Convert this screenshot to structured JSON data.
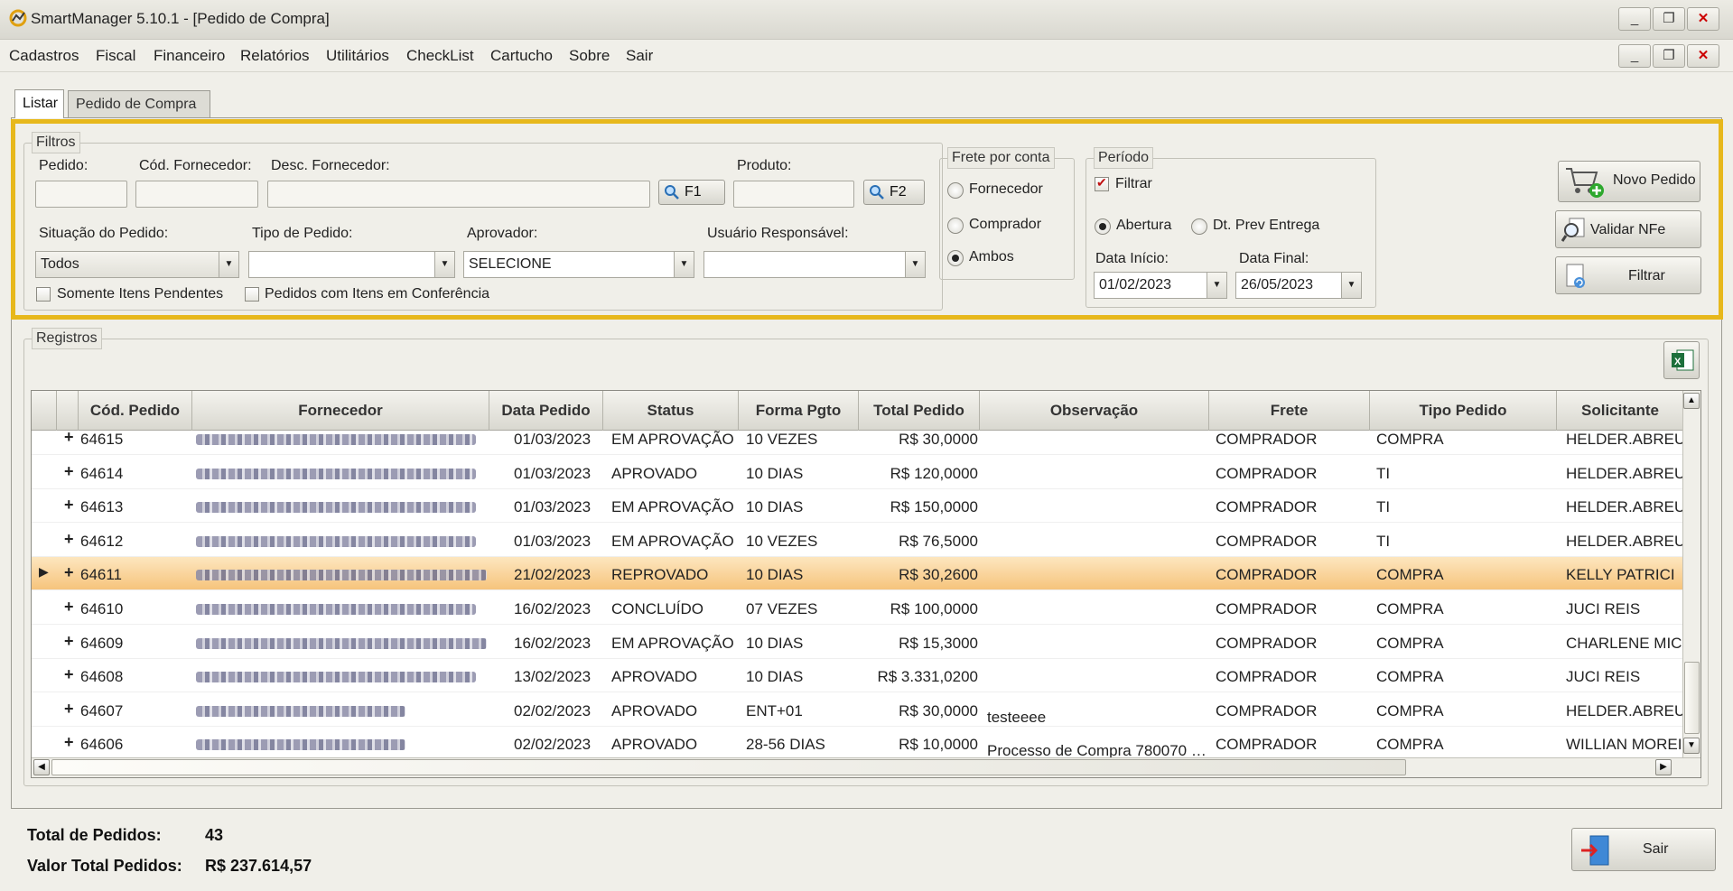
{
  "window": {
    "title": "SmartManager 5.10.1 - [Pedido de Compra]",
    "controls": [
      "_",
      "❐",
      "✕"
    ]
  },
  "menu": [
    "Cadastros",
    "Fiscal",
    "Financeiro",
    "Relatórios",
    "Utilitários",
    "CheckList",
    "Cartucho",
    "Sobre",
    "Sair"
  ],
  "tabs": [
    {
      "label": "Listar",
      "active": true
    },
    {
      "label": "Pedido de Compra",
      "active": false
    }
  ],
  "filtros": {
    "legend": "Filtros",
    "pedido_label": "Pedido:",
    "cod_fornecedor_label": "Cód. Fornecedor:",
    "desc_fornecedor_label": "Desc. Fornecedor:",
    "f1_label": "F1",
    "produto_label": "Produto:",
    "f2_label": "F2",
    "situacao_label": "Situação do Pedido:",
    "situacao_value": "Todos",
    "tipo_label": "Tipo de Pedido:",
    "tipo_value": "",
    "aprovador_label": "Aprovador:",
    "aprovador_value": "SELECIONE",
    "usuario_label": "Usuário Responsável:",
    "usuario_value": "",
    "somente_pendentes_label": "Somente Itens Pendentes",
    "conferencia_label": "Pedidos com Itens em Conferência"
  },
  "frete": {
    "legend": "Frete por conta",
    "options": [
      "Fornecedor",
      "Comprador",
      "Ambos"
    ],
    "selected": "Ambos"
  },
  "periodo": {
    "legend": "Período",
    "filtrar_label": "Filtrar",
    "filtrar_checked": true,
    "abertura_label": "Abertura",
    "dt_prev_label": "Dt. Prev Entrega",
    "selected": "Abertura",
    "data_inicio_label": "Data Início:",
    "data_inicio": "01/02/2023",
    "data_final_label": "Data Final:",
    "data_final": "26/05/2023"
  },
  "buttons": {
    "novo_pedido": "Novo Pedido",
    "validar_nfe": "Validar NFe",
    "filtrar": "Filtrar",
    "sair": "Sair"
  },
  "registros": {
    "legend": "Registros",
    "columns": [
      "Cód. Pedido",
      "Fornecedor",
      "Data Pedido",
      "Status",
      "Forma Pgto",
      "Total Pedido",
      "Observação",
      "Frete",
      "Tipo Pedido",
      "Solicitante"
    ],
    "rows": [
      {
        "cod": "64615",
        "data": "01/03/2023",
        "status": "EM APROVAÇÃO",
        "forma": "10 VEZES",
        "total": "R$ 30,0000",
        "obs": "",
        "frete": "COMPRADOR",
        "tipo": "COMPRA",
        "solicitante": "HELDER.ABREU"
      },
      {
        "cod": "64614",
        "data": "01/03/2023",
        "status": "APROVADO",
        "forma": "10 DIAS",
        "total": "R$ 120,0000",
        "obs": "",
        "frete": "COMPRADOR",
        "tipo": "TI",
        "solicitante": "HELDER.ABREU"
      },
      {
        "cod": "64613",
        "data": "01/03/2023",
        "status": "EM APROVAÇÃO",
        "forma": "10 DIAS",
        "total": "R$ 150,0000",
        "obs": "",
        "frete": "COMPRADOR",
        "tipo": "TI",
        "solicitante": "HELDER.ABREU"
      },
      {
        "cod": "64612",
        "data": "01/03/2023",
        "status": "EM APROVAÇÃO",
        "forma": "10 VEZES",
        "total": "R$ 76,5000",
        "obs": "",
        "frete": "COMPRADOR",
        "tipo": "TI",
        "solicitante": "HELDER.ABREU"
      },
      {
        "cod": "64611",
        "data": "21/02/2023",
        "status": "REPROVADO",
        "forma": "10 DIAS",
        "total": "R$ 30,2600",
        "obs": "",
        "frete": "COMPRADOR",
        "tipo": "COMPRA",
        "solicitante": "KELLY PATRICI"
      },
      {
        "cod": "64610",
        "data": "16/02/2023",
        "status": "CONCLUÍDO",
        "forma": "07 VEZES",
        "total": "R$ 100,0000",
        "obs": "",
        "frete": "COMPRADOR",
        "tipo": "COMPRA",
        "solicitante": "JUCI REIS"
      },
      {
        "cod": "64609",
        "data": "16/02/2023",
        "status": "EM APROVAÇÃO",
        "forma": "10 DIAS",
        "total": "R$ 15,3000",
        "obs": "",
        "frete": "COMPRADOR",
        "tipo": "COMPRA",
        "solicitante": "CHARLENE MIC"
      },
      {
        "cod": "64608",
        "data": "13/02/2023",
        "status": "APROVADO",
        "forma": "10 DIAS",
        "total": "R$ 3.331,0200",
        "obs": "",
        "frete": "COMPRADOR",
        "tipo": "COMPRA",
        "solicitante": "JUCI REIS"
      },
      {
        "cod": "64607",
        "data": "02/02/2023",
        "status": "APROVADO",
        "forma": "ENT+01",
        "total": "R$ 30,0000",
        "obs": "testeeee",
        "frete": "COMPRADOR",
        "tipo": "COMPRA",
        "solicitante": "HELDER.ABREU"
      },
      {
        "cod": "64606",
        "data": "02/02/2023",
        "status": "APROVADO",
        "forma": "28-56 DIAS",
        "total": "R$ 10,0000",
        "obs": "Processo de Compra 780070 -...",
        "frete": "COMPRADOR",
        "tipo": "COMPRA",
        "solicitante": "WILLIAN MOREI"
      }
    ],
    "selected_row": 4
  },
  "totals": {
    "total_pedidos_label": "Total de Pedidos:",
    "total_pedidos": "43",
    "valor_total_label": "Valor Total Pedidos:",
    "valor_total": "R$ 237.614,57"
  }
}
